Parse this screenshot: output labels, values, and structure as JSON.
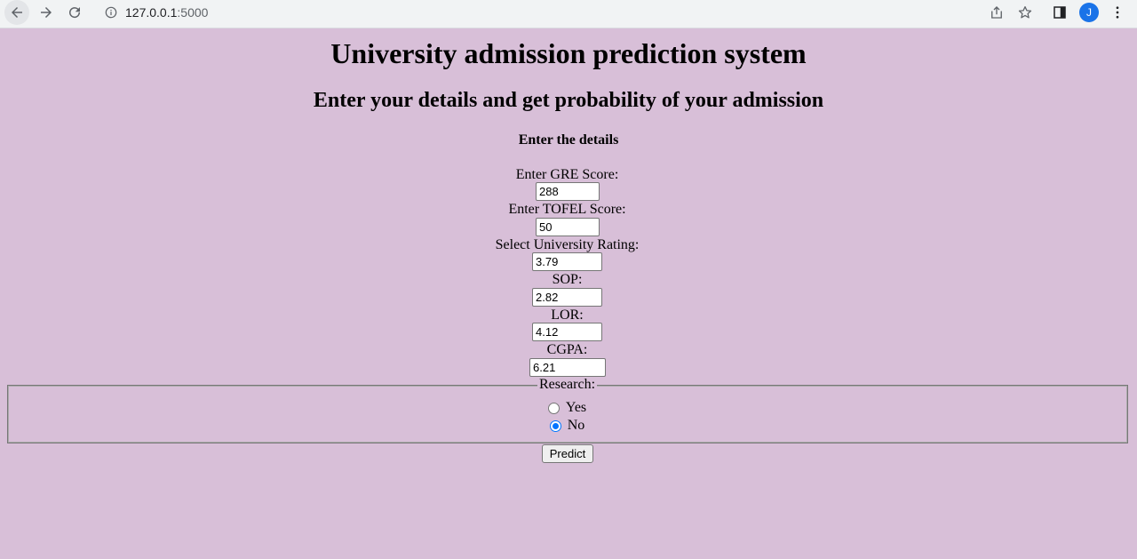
{
  "browser": {
    "url_host": "127.0.0.1",
    "url_port": ":5000",
    "avatar_initial": "J"
  },
  "page": {
    "title": "University admission prediction system",
    "subtitle": "Enter your details and get probability of your admission",
    "form_heading": "Enter the details"
  },
  "fields": {
    "gre": {
      "label": "Enter GRE Score:",
      "value": "288"
    },
    "tofel": {
      "label": "Enter TOFEL Score:",
      "value": "50"
    },
    "rating": {
      "label": "Select University Rating:",
      "value": "3.79"
    },
    "sop": {
      "label": "SOP:",
      "value": "2.82"
    },
    "lor": {
      "label": "LOR:",
      "value": "4.12"
    },
    "cgpa": {
      "label": "CGPA:",
      "value": "6.21"
    }
  },
  "research": {
    "legend": "Research:",
    "options": [
      {
        "label": "Yes",
        "checked": false
      },
      {
        "label": "No",
        "checked": true
      }
    ]
  },
  "submit_label": "Predict",
  "colors": {
    "page_background": "#d8bfd8",
    "radio_accent": "#0075ff",
    "avatar": "#1a73e8"
  }
}
